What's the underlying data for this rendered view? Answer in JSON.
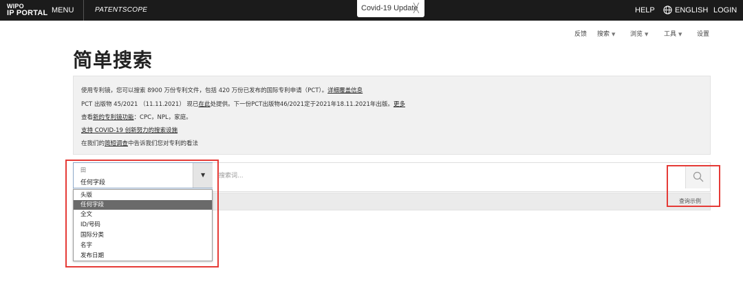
{
  "topbar": {
    "logo_line1": "WIPO",
    "logo_line2": "IP PORTAL",
    "menu": "MENU",
    "brand": "PATENTSCOPE",
    "covid_label": "Covid-19 Update",
    "covid_close": "╳",
    "help": "HELP",
    "language": "ENGLISH",
    "login": "LOGIN"
  },
  "subnav": {
    "feedback": "反馈",
    "search": "搜索",
    "browse": "浏览",
    "tools": "工具",
    "settings": "设置"
  },
  "page_title": "简单搜索",
  "info": {
    "line1_text": "使用专利镜，您可以搜索 8900 万份专利文件，包括 420 万份已发布的国际专利申请（PCT）。",
    "line1_link": "详细覆盖信息",
    "line2_text": "PCT 出版物 45/2021 （11.11.2021） 现已",
    "line2_link": "在此",
    "line2_rest": "处提供。下一份PCT出版物46/2021定于2021年18.11.2021年出版。",
    "line2_more": "更多",
    "line3_text": "查看",
    "line3_link": "新的专利镜功能",
    "line3_rest": "：CPC，NPL，家庭。",
    "line4_link": "支持 COVID-19 创新努力的搜索设施",
    "line5_text": "在我们的",
    "line5_link": "简短调查",
    "line5_rest": "中告诉我们您对专利的看法"
  },
  "search": {
    "field_small": "田",
    "field_value": "任何字段",
    "placeholder": "搜索词...",
    "examples": "查询示例"
  },
  "dropdown": {
    "options": [
      "头版",
      "任何字段",
      "全文",
      "ID/号码",
      "国际分类",
      "名字",
      "发布日期"
    ],
    "selected_index": 1
  },
  "colors": {
    "topbar_bg": "#1b1b1b",
    "annotation_red": "#e53935",
    "selected_option": "#6a6a6a"
  }
}
